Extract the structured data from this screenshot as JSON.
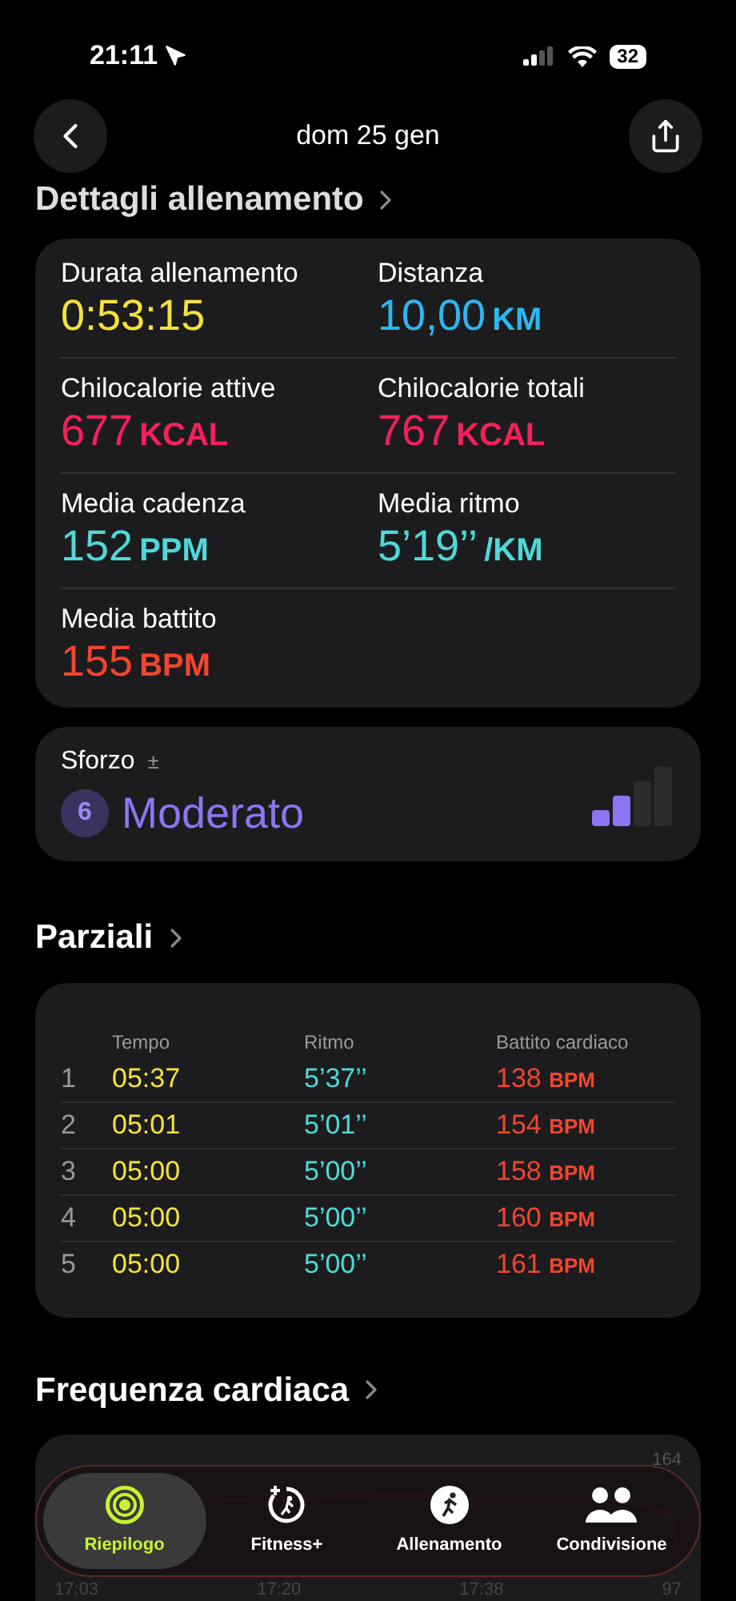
{
  "status_bar": {
    "time": "21:11",
    "battery": "32"
  },
  "nav": {
    "title": "dom 25 gen"
  },
  "details": {
    "title": "Dettagli allenamento",
    "metrics": [
      {
        "label": "Durata allenamento",
        "value": "0:53:15",
        "color": "#f5e13a"
      },
      {
        "label": "Distanza",
        "value": "10,00",
        "unit": "KM",
        "color": "#2fb6f0"
      },
      {
        "label": "Chilocalorie attive",
        "value": "677",
        "unit": "KCAL",
        "color": "#f5215a"
      },
      {
        "label": "Chilocalorie totali",
        "value": "767",
        "unit": "KCAL",
        "color": "#f5215a"
      },
      {
        "label": "Media cadenza",
        "value": "152",
        "unit": "PPM",
        "color": "#4fd8d8"
      },
      {
        "label": "Media ritmo",
        "value": "5’19’’",
        "unit": "/KM",
        "color": "#4fd8d8"
      },
      {
        "label": "Media battito",
        "value": "155",
        "unit": "BPM",
        "color": "#f2452f"
      }
    ]
  },
  "effort": {
    "label": "Sforzo",
    "adjust": "±",
    "score": "6",
    "rating": "Moderato",
    "level": 0.5
  },
  "splits": {
    "title": "Parziali",
    "columns": [
      "Tempo",
      "Ritmo",
      "Battito cardiaco"
    ],
    "rows": [
      {
        "index": "1",
        "time": "05:37",
        "pace": "5’37’’",
        "bpm": "138",
        "unit": "BPM"
      },
      {
        "index": "2",
        "time": "05:01",
        "pace": "5’01’’",
        "bpm": "154",
        "unit": "BPM"
      },
      {
        "index": "3",
        "time": "05:00",
        "pace": "5’00’’",
        "bpm": "158",
        "unit": "BPM"
      },
      {
        "index": "4",
        "time": "05:00",
        "pace": "5’00’’",
        "bpm": "160",
        "unit": "BPM"
      },
      {
        "index": "5",
        "time": "05:00",
        "pace": "5’00’’",
        "bpm": "161",
        "unit": "BPM"
      }
    ]
  },
  "heart_rate": {
    "title": "Frequenza cardiaca",
    "max": "164",
    "min": "97",
    "times": [
      "17:03",
      "17:20",
      "17:38"
    ]
  },
  "tab_bar": [
    {
      "label": "Riepilogo",
      "selected": true,
      "kind": "rings"
    },
    {
      "label": "Fitness+",
      "selected": false,
      "kind": "fitness"
    },
    {
      "label": "Allenamento",
      "selected": false,
      "kind": "runner"
    },
    {
      "label": "Condivisione",
      "selected": false,
      "kind": "people"
    }
  ]
}
